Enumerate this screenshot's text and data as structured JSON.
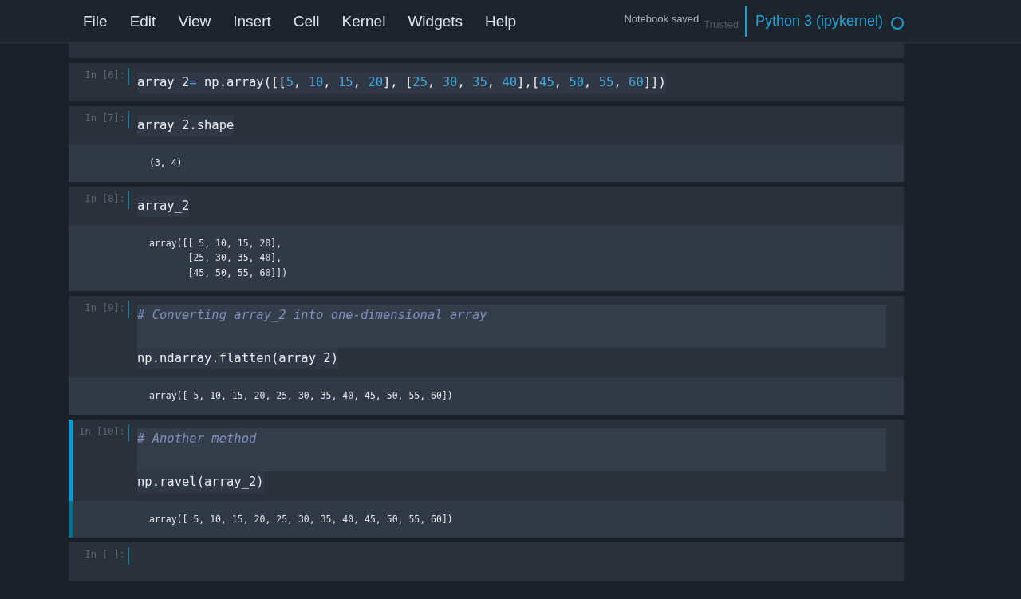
{
  "menu": [
    "File",
    "Edit",
    "View",
    "Insert",
    "Cell",
    "Kernel",
    "Widgets",
    "Help"
  ],
  "status": {
    "notification": "Notebook saved",
    "trusted": "Trusted",
    "kernel": "Python 3 (ipykernel)",
    "kernel_busy": false
  },
  "cells": [
    {
      "prompt": "In [6]:",
      "selected": false,
      "lines": [
        {
          "tokens": [
            {
              "kind": "plain",
              "text": "array_2"
            },
            {
              "kind": "op",
              "text": "="
            },
            {
              "kind": "plain",
              "text": " np.array([["
            },
            {
              "kind": "num",
              "text": "5"
            },
            {
              "kind": "plain",
              "text": ", "
            },
            {
              "kind": "num",
              "text": "10"
            },
            {
              "kind": "plain",
              "text": ", "
            },
            {
              "kind": "num",
              "text": "15"
            },
            {
              "kind": "plain",
              "text": ", "
            },
            {
              "kind": "num",
              "text": "20"
            },
            {
              "kind": "plain",
              "text": "], ["
            },
            {
              "kind": "num",
              "text": "25"
            },
            {
              "kind": "plain",
              "text": ", "
            },
            {
              "kind": "num",
              "text": "30"
            },
            {
              "kind": "plain",
              "text": ", "
            },
            {
              "kind": "num",
              "text": "35"
            },
            {
              "kind": "plain",
              "text": ", "
            },
            {
              "kind": "num",
              "text": "40"
            },
            {
              "kind": "plain",
              "text": "],["
            },
            {
              "kind": "num",
              "text": "45"
            },
            {
              "kind": "plain",
              "text": ", "
            },
            {
              "kind": "num",
              "text": "50"
            },
            {
              "kind": "plain",
              "text": ", "
            },
            {
              "kind": "num",
              "text": "55"
            },
            {
              "kind": "plain",
              "text": ", "
            },
            {
              "kind": "num",
              "text": "60"
            },
            {
              "kind": "plain",
              "text": "]])"
            }
          ]
        }
      ]
    },
    {
      "prompt": "In [7]:",
      "selected": false,
      "lines": [
        {
          "tokens": [
            {
              "kind": "plain",
              "text": "array_2.shape"
            }
          ]
        }
      ],
      "output": [
        "(3, 4)"
      ]
    },
    {
      "prompt": "In [8]:",
      "selected": false,
      "lines": [
        {
          "tokens": [
            {
              "kind": "plain",
              "text": "array_2"
            }
          ]
        }
      ],
      "output": [
        "array([[ 5, 10, 15, 20],",
        "       [25, 30, 35, 40],",
        "       [45, 50, 55, 60]])"
      ]
    },
    {
      "prompt": "In [9]:",
      "selected": false,
      "lines": [
        {
          "tokens": [
            {
              "kind": "comment",
              "text": "# Converting array_2 into one-dimensional array"
            }
          ],
          "blank_after": true
        },
        {
          "tokens": [
            {
              "kind": "plain",
              "text": "np.ndarray.flatten(array_2)"
            }
          ]
        }
      ],
      "output": [
        "array([ 5, 10, 15, 20, 25, 30, 35, 40, 45, 50, 55, 60])"
      ]
    },
    {
      "prompt": "In [10]:",
      "selected": true,
      "lines": [
        {
          "tokens": [
            {
              "kind": "comment",
              "text": "# Another method"
            }
          ],
          "blank_after": true
        },
        {
          "tokens": [
            {
              "kind": "plain",
              "text": "np.ravel(array_2)"
            }
          ]
        }
      ],
      "output": [
        "array([ 5, 10, 15, 20, 25, 30, 35, 40, 45, 50, 55, 60])"
      ]
    },
    {
      "prompt": "In [ ]:",
      "selected": false
    }
  ]
}
